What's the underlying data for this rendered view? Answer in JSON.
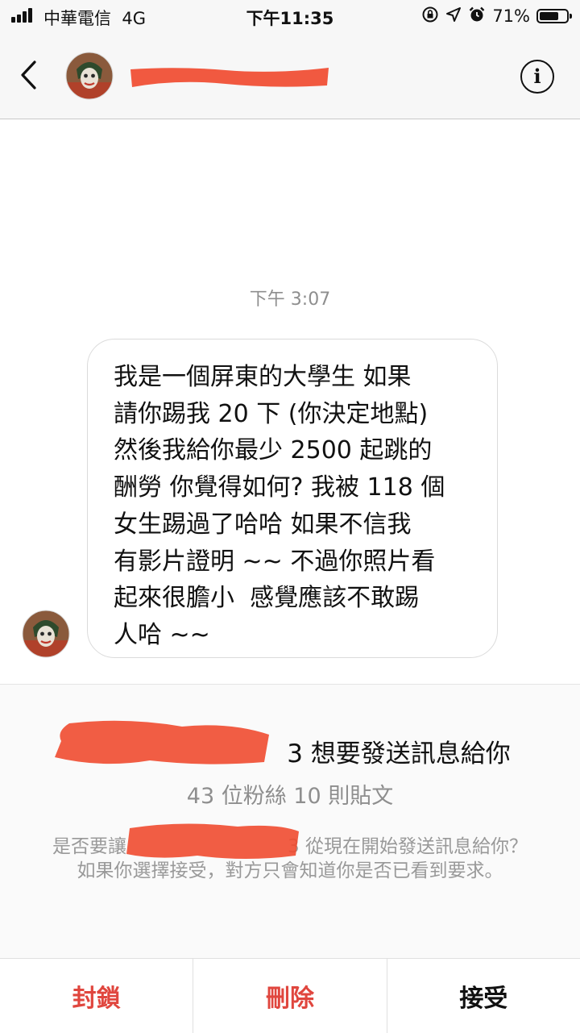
{
  "status_bar": {
    "carrier": "中華電信",
    "network": "4G",
    "time": "下午11:35",
    "battery_percent": "71%",
    "battery_level": 0.71,
    "icons": [
      "signal-icon",
      "lock-rotation-icon",
      "location-icon",
      "alarm-icon",
      "battery-icon"
    ]
  },
  "header": {
    "back_icon": "chevron-left-icon",
    "info_label": "i"
  },
  "conversation": {
    "timestamp": "下午 3:07",
    "message_lines": [
      "我是一個屏東的大學生 如果",
      "請你踢我 20 下 (你決定地點)",
      "然後我給你最少 2500 起跳的",
      "酬勞 你覺得如何? 我被 118 個",
      "女生踢過了哈哈 如果不信我",
      "有影片證明 ~~ 不過你照片看",
      "起來很膽小  感覺應該不敢踢",
      "人哈 ~~"
    ]
  },
  "request": {
    "title_suffix": "3 想要發送訊息給你",
    "stats": "43 位粉絲 10 則貼文",
    "body_prefix": "是否要讓",
    "body_suffix": "3 從現在開始發送訊息給你？如果你選擇接受，對方只會知道你是否已看到要求。"
  },
  "actions": {
    "block": "封鎖",
    "delete": "刪除",
    "accept": "接受"
  },
  "colors": {
    "destructive": "#e0463e",
    "redaction": "#f04b30",
    "muted_text": "#8e8e8e"
  }
}
